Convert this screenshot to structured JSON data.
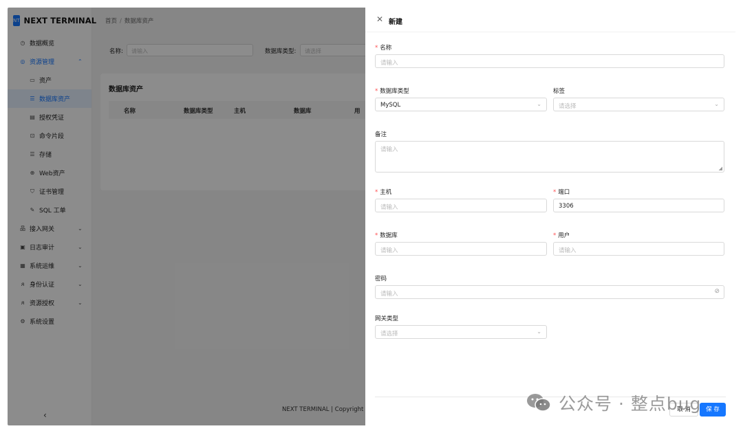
{
  "app": {
    "logo_badge": "NT",
    "title": "NEXT TERMINAL"
  },
  "sidebar": {
    "items": [
      {
        "label": "数据概览",
        "icon": "dashboard-icon"
      },
      {
        "label": "资源管理",
        "icon": "resource-icon",
        "expanded": true
      },
      {
        "label": "资产",
        "icon": "monitor-icon"
      },
      {
        "label": "数据库资产",
        "icon": "database-icon",
        "active": true
      },
      {
        "label": "授权凭证",
        "icon": "credential-icon"
      },
      {
        "label": "命令片段",
        "icon": "terminal-icon"
      },
      {
        "label": "存储",
        "icon": "storage-icon"
      },
      {
        "label": "Web资产",
        "icon": "globe-icon"
      },
      {
        "label": "证书管理",
        "icon": "certificate-icon"
      },
      {
        "label": "SQL 工单",
        "icon": "edit-icon"
      },
      {
        "label": "接入网关",
        "icon": "gateway-icon"
      },
      {
        "label": "日志审计",
        "icon": "audit-icon"
      },
      {
        "label": "系统运维",
        "icon": "ops-icon"
      },
      {
        "label": "身份认证",
        "icon": "user-icon"
      },
      {
        "label": "资源授权",
        "icon": "user-icon"
      },
      {
        "label": "系统设置",
        "icon": "settings-icon"
      }
    ],
    "collapse_glyph": "‹"
  },
  "breadcrumb": {
    "home": "首页",
    "separator": "/",
    "current": "数据库资产"
  },
  "filters": {
    "name_label": "名称:",
    "name_placeholder": "请输入",
    "type_label": "数据库类型:",
    "type_placeholder": "请选择"
  },
  "table": {
    "title": "数据库资产",
    "columns": [
      "名称",
      "数据库类型",
      "主机",
      "数据库",
      "用"
    ]
  },
  "page_footer": "NEXT TERMINAL | Copyright ©",
  "drawer": {
    "title": "新建",
    "fields": {
      "name": {
        "label": "名称",
        "placeholder": "请输入"
      },
      "db_type": {
        "label": "数据库类型",
        "value": "MySQL"
      },
      "tags": {
        "label": "标签",
        "placeholder": "请选择"
      },
      "remark": {
        "label": "备注",
        "placeholder": "请输入"
      },
      "host": {
        "label": "主机",
        "placeholder": "请输入"
      },
      "port": {
        "label": "端口",
        "value": "3306"
      },
      "database": {
        "label": "数据库",
        "placeholder": "请输入"
      },
      "user": {
        "label": "用户",
        "placeholder": "请输入"
      },
      "password": {
        "label": "密码",
        "placeholder": "请输入"
      },
      "gateway_type": {
        "label": "网关类型",
        "placeholder": "请选择"
      }
    },
    "buttons": {
      "cancel": "取 消",
      "save": "保 存"
    }
  },
  "watermark": {
    "text": "公众号 · 整点bug"
  },
  "colors": {
    "primary": "#1677ff",
    "required": "#ff4d4f",
    "active_bg": "#e6f0ff"
  }
}
